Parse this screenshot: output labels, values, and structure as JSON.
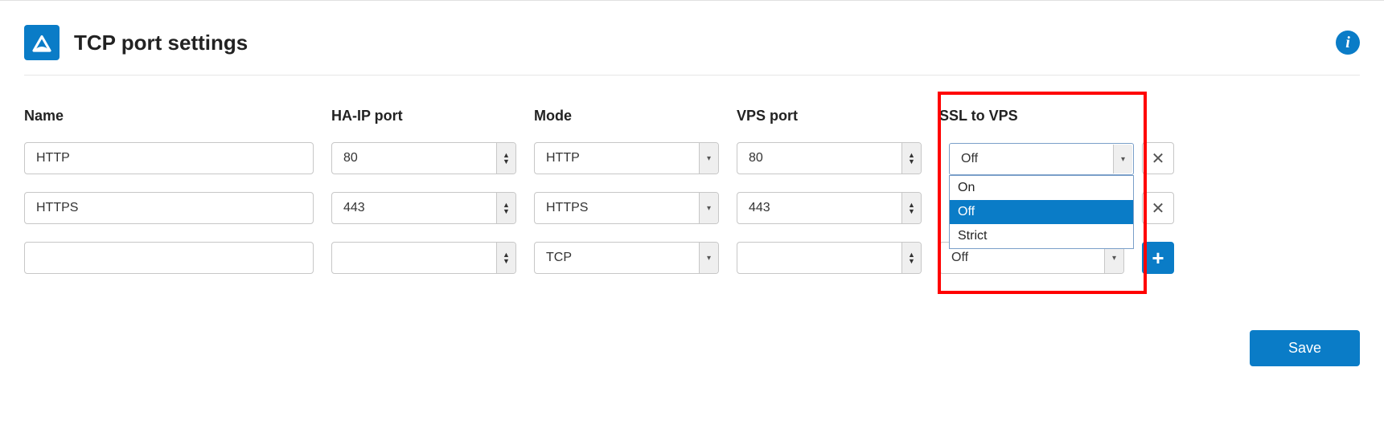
{
  "header": {
    "title": "TCP port settings"
  },
  "columns": {
    "name": "Name",
    "haip_port": "HA-IP port",
    "mode": "Mode",
    "vps_port": "VPS port",
    "ssl_to_vps": "SSL to VPS"
  },
  "mode_options": [
    "HTTP",
    "HTTPS",
    "TCP"
  ],
  "ssl_options": [
    "On",
    "Off",
    "Strict"
  ],
  "rows": [
    {
      "name": "HTTP",
      "haip_port": "80",
      "mode": "HTTP",
      "vps_port": "80",
      "ssl": "Off"
    },
    {
      "name": "HTTPS",
      "haip_port": "443",
      "mode": "HTTPS",
      "vps_port": "443",
      "ssl": "Off"
    },
    {
      "name": "",
      "haip_port": "",
      "mode": "TCP",
      "vps_port": "",
      "ssl": "Off"
    }
  ],
  "dropdown_open": {
    "row": 0,
    "selected": "Off"
  },
  "buttons": {
    "save": "Save"
  }
}
